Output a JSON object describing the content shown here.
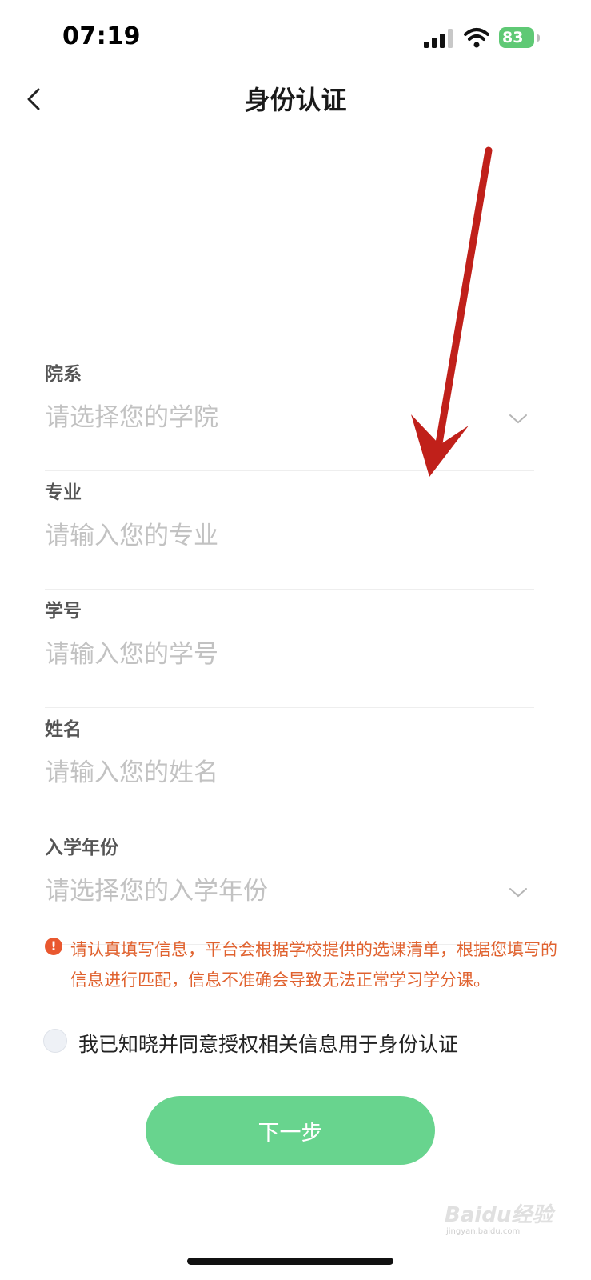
{
  "status_bar": {
    "time": "07:19",
    "battery": "83"
  },
  "nav": {
    "title": "身份认证"
  },
  "form": {
    "fields": [
      {
        "label": "院系",
        "placeholder": "请选择您的学院",
        "type": "select"
      },
      {
        "label": "专业",
        "placeholder": "请输入您的专业",
        "type": "text"
      },
      {
        "label": "学号",
        "placeholder": "请输入您的学号",
        "type": "text"
      },
      {
        "label": "姓名",
        "placeholder": "请输入您的姓名",
        "type": "text"
      },
      {
        "label": "入学年份",
        "placeholder": "请选择您的入学年份",
        "type": "select"
      }
    ]
  },
  "notice": {
    "icon": "!",
    "text": "请认真填写信息，平台会根据学校提供的选课清单，根据您填写的信息进行匹配，信息不准确会导致无法正常学习学分课。"
  },
  "agreement": {
    "label": "我已知晓并同意授权相关信息用于身份认证"
  },
  "next_button": {
    "label": "下一步"
  },
  "watermark": {
    "text": "Baidu经验",
    "sub": "jingyan.baidu.com"
  },
  "colors": {
    "primary": "#68d48e",
    "warning": "#e0622f",
    "annotation_arrow": "#c0201a"
  }
}
